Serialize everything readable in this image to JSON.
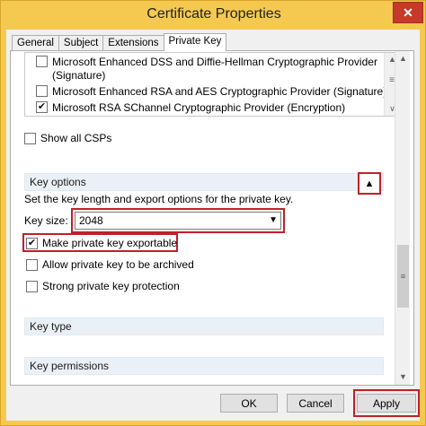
{
  "window": {
    "title": "Certificate Properties",
    "close_glyph": "✕"
  },
  "tabs": [
    {
      "label": "General"
    },
    {
      "label": "Subject"
    },
    {
      "label": "Extensions"
    },
    {
      "label": "Private Key",
      "active": true
    }
  ],
  "providers": [
    {
      "label": "Microsoft Enhanced DSS and Diffie-Hellman Cryptographic Provider",
      "label2": "(Signature)",
      "checked": false
    },
    {
      "label": "Microsoft Enhanced RSA and AES Cryptographic Provider (Signature)",
      "checked": false
    },
    {
      "label": "Microsoft RSA SChannel Cryptographic Provider (Encryption)",
      "checked": true
    }
  ],
  "show_all_csps": {
    "label": "Show all CSPs",
    "checked": false
  },
  "key_options": {
    "header": "Key options",
    "description": "Set the key length and export options for the private key.",
    "key_size_label": "Key size:",
    "key_size_value": "2048",
    "options": [
      {
        "label": "Make private key exportable",
        "checked": true
      },
      {
        "label": "Allow private key to be archived",
        "checked": false
      },
      {
        "label": "Strong private key protection",
        "checked": false
      }
    ]
  },
  "sections": [
    {
      "label": "Key type"
    },
    {
      "label": "Key permissions"
    }
  ],
  "buttons": {
    "ok": "OK",
    "cancel": "Cancel",
    "apply": "Apply"
  },
  "icons": {
    "collapse": "chevron-up-icon",
    "dropdown": "chevron-down-icon",
    "scroll_up": "arrow-up-icon",
    "scroll_down": "arrow-down-icon",
    "grip": "scroll-grip-icon"
  },
  "colors": {
    "title_bar": "#f5c94f",
    "close_button": "#c7392b",
    "highlight_outline": "#c0202a",
    "section_header": "#eaf0f7"
  }
}
